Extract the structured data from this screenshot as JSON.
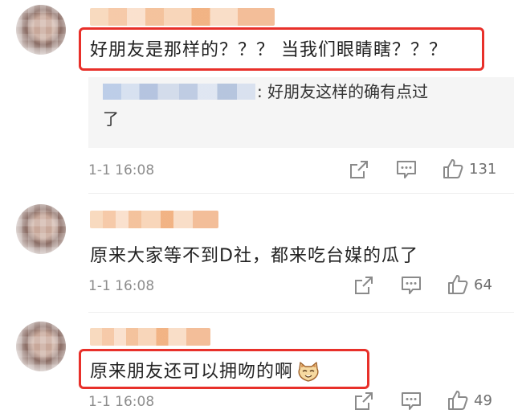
{
  "comments": [
    {
      "text": "好朋友是那样的？？？ 当我们眼睛瞎？？？",
      "reply": {
        "line1": ": 好朋友这样的确有点过",
        "line2": "了"
      },
      "time": "1-1 16:08",
      "likes": "131"
    },
    {
      "text": "原来大家等不到D社，都来吃台媒的瓜了",
      "time": "1-1 16:08",
      "likes": "64"
    },
    {
      "text": "原来朋友还可以拥吻的啊",
      "emoji": "cat-face-emoji",
      "time": "1-1 16:08",
      "likes": "49"
    }
  ],
  "colors": {
    "highlight": "#e8302a",
    "meta": "#8d8d8d",
    "icon": "#8a8a8a"
  }
}
